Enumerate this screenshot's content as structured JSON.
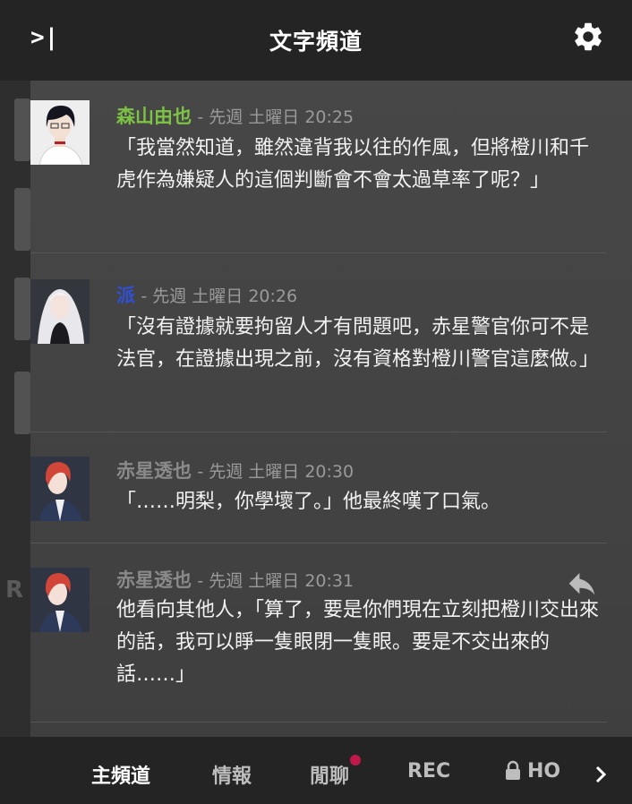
{
  "header": {
    "title": "文字頻道",
    "collapse_icon": "collapse-right-icon",
    "settings_icon": "gear-icon"
  },
  "messages": [
    {
      "author": "森山由也",
      "author_color": "#7cc243",
      "time": "- 先週 土曜日 20:25",
      "text": "「我當然知道，雖然違背我以往的作風，但將橙川和千虎作為嫌疑人的這個判斷會不會太過草率了呢？」"
    },
    {
      "author": "派",
      "author_color": "#2f4fd6",
      "time": "- 先週 土曜日 20:26",
      "text": "「沒有證據就要拘留人才有問題吧，赤星警官你可不是法官，在證據出現之前，沒有資格對橙川警官這麼做。」"
    },
    {
      "author": "赤星透也",
      "author_color": "#8a8a8a",
      "time": "- 先週 土曜日 20:30",
      "text": "「……明梨，你學壞了。」他最終嘆了口氣。"
    },
    {
      "author": "赤星透也",
      "author_color": "#8a8a8a",
      "time": "- 先週 土曜日 20:31",
      "text": "他看向其他人，「算了，要是你們現在立刻把橙川交出來的話，我可以睜一隻眼閉一隻眼。要是不交出來的話……」"
    }
  ],
  "tabs": [
    {
      "label": "主頻道",
      "active": true
    },
    {
      "label": "情報",
      "active": false
    },
    {
      "label": "閒聊",
      "active": false,
      "unread": true
    },
    {
      "label": "REC",
      "active": false
    },
    {
      "label": "HO",
      "active": false,
      "locked": true
    }
  ],
  "colors": {
    "header_bg": "#242424",
    "panel_bg": "#444444",
    "unread_dot": "#c0184a"
  }
}
